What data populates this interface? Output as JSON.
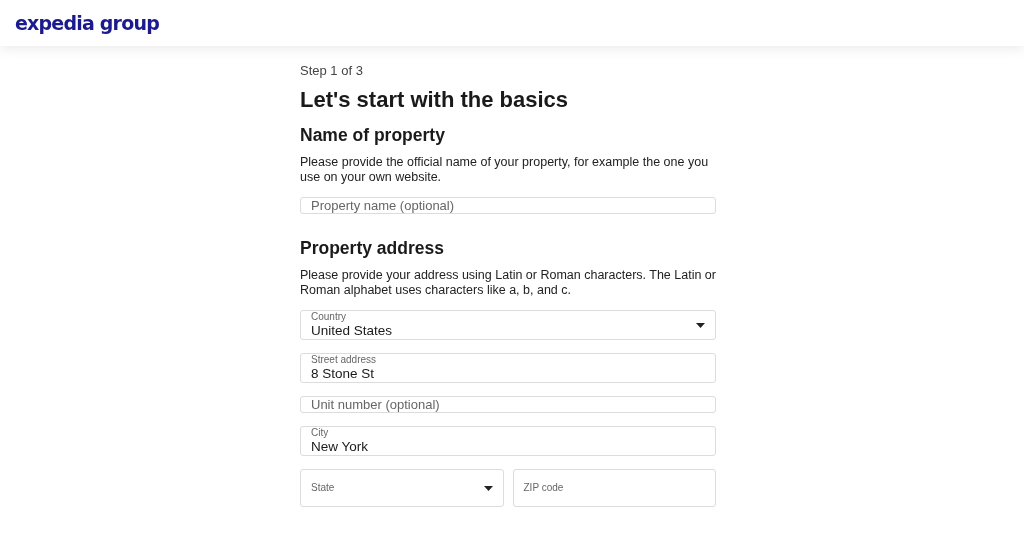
{
  "header": {
    "logo": "expedia group"
  },
  "step": "Step 1 of 3",
  "title": "Let's start with the basics",
  "sections": [
    {
      "title": "Name of property",
      "description": "Please provide the official name of your property, for example the one you use on your own website.",
      "fields": [
        {
          "kind": "text",
          "placeholder": "Property name (optional)"
        }
      ]
    },
    {
      "title": "Property address",
      "description": "Please provide your address using Latin or Roman characters. The Latin or Roman alphabet uses characters like a, b, and c.",
      "fields": [
        {
          "kind": "select",
          "label": "Country",
          "value": "United States"
        },
        {
          "kind": "text",
          "label": "Street address",
          "value": "8 Stone St"
        },
        {
          "kind": "text",
          "placeholder": "Unit number (optional)"
        },
        {
          "kind": "text",
          "label": "City",
          "value": "New York"
        },
        {
          "kind": "row",
          "fields": [
            {
              "kind": "select",
              "label": "State"
            },
            {
              "kind": "text",
              "label": "ZIP code"
            }
          ]
        }
      ]
    }
  ]
}
